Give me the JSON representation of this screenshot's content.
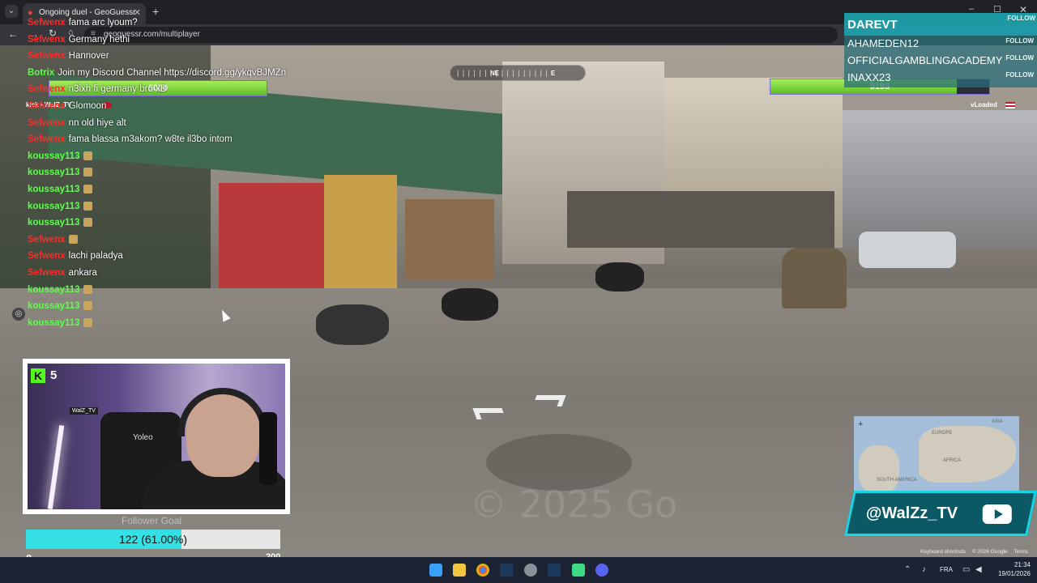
{
  "browser": {
    "tab_title": "Ongoing duel - GeoGuessr",
    "url": "geoguessr.com/multiplayer"
  },
  "compass": {
    "ticks": "| | | | |  |  | | | | | |  | | | | |",
    "ne": "NE",
    "e": "E"
  },
  "duel": {
    "left": {
      "hp": "6000",
      "hp_fraction": 1.0,
      "name": "kick • WalZ_TV"
    },
    "right": {
      "hp": "5193",
      "hp_fraction": 0.85,
      "name": "vLoaded"
    }
  },
  "chat": [
    {
      "user": "Sefwenx",
      "color": "#ff2a2a",
      "msg": "fama arc lyoum?"
    },
    {
      "user": "Sefwenx",
      "color": "#ff2a2a",
      "msg": "Germany hethi"
    },
    {
      "user": "Sefwenx",
      "color": "#ff2a2a",
      "msg": "Hannover"
    },
    {
      "user": "Botrix",
      "color": "#5bff4a",
      "msg": "Join my Discord Channel https://discord.gg/ykqvBJMZn"
    },
    {
      "user": "Sefwenx",
      "color": "#ff2a2a",
      "msg": "n3ixh fi germany bro xD"
    },
    {
      "user": "Sefwenx",
      "color": "#ff2a2a",
      "msg": "Glomoon"
    },
    {
      "user": "Sefwenx",
      "color": "#ff2a2a",
      "msg": "nn old hiye alt"
    },
    {
      "user": "Sefwenx",
      "color": "#ff2a2a",
      "msg": "fama blassa m3akom? w8te il3bo intom"
    },
    {
      "user": "koussay113",
      "color": "#5bff4a",
      "msg": ""
    },
    {
      "user": "koussay113",
      "color": "#5bff4a",
      "msg": ""
    },
    {
      "user": "koussay113",
      "color": "#5bff4a",
      "msg": ""
    },
    {
      "user": "koussay113",
      "color": "#5bff4a",
      "msg": ""
    },
    {
      "user": "koussay113",
      "color": "#5bff4a",
      "msg": ""
    },
    {
      "user": "Sefwenx",
      "color": "#ff2a2a",
      "msg": ""
    },
    {
      "user": "Sefwenx",
      "color": "#ff2a2a",
      "msg": "lachi paladya"
    },
    {
      "user": "Sefwenx",
      "color": "#ff2a2a",
      "msg": "ankara"
    },
    {
      "user": "koussay113",
      "color": "#5bff4a",
      "msg": ""
    },
    {
      "user": "koussay113",
      "color": "#5bff4a",
      "msg": ""
    },
    {
      "user": "koussay113",
      "color": "#5bff4a",
      "msg": ""
    }
  ],
  "webcam": {
    "viewers": "5",
    "chair_text": "Yoleo",
    "sign": "WalZ_TV"
  },
  "follower_goal": {
    "title": "Follower Goal",
    "text": "122 (61.00%)",
    "fraction": 0.61,
    "min": "0",
    "max": "200"
  },
  "followers": [
    {
      "name": "DAREVT",
      "action": "FOLLOW"
    },
    {
      "name": "AHAMEDEN12",
      "action": "FOLLOW"
    },
    {
      "name": "OFFICIALGAMBLINGACADEMY",
      "action": "FOLLOW"
    },
    {
      "name": "INAXX23",
      "action": "FOLLOW"
    }
  ],
  "minimap": {
    "labels": [
      "ASIA",
      "EUROPE",
      "AFRICA",
      "SOUTH AMERICA"
    ]
  },
  "youtube": {
    "handle": "@WalZz_TV"
  },
  "attribution": {
    "shortcuts": "Keyboard shortcuts",
    "copyright": "© 2026 Google",
    "terms": "Terms"
  },
  "watermark": "© 2025 Go",
  "taskbar": {
    "lang": "FRA",
    "time": "21:34",
    "date": "19/01/2026"
  }
}
